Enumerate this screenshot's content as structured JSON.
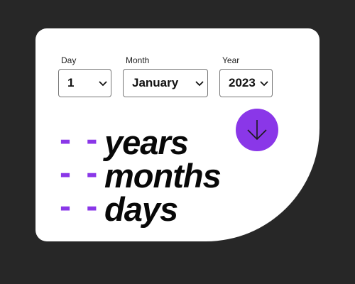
{
  "form": {
    "day": {
      "label": "Day",
      "value": "1"
    },
    "month": {
      "label": "Month",
      "value": "January"
    },
    "year": {
      "label": "Year",
      "value": "2023"
    }
  },
  "submit": {
    "icon": "arrow-down-icon",
    "color": "#8a37e8"
  },
  "results": [
    {
      "value": "- -",
      "unit": "years"
    },
    {
      "value": "- -",
      "unit": "months"
    },
    {
      "value": "- -",
      "unit": "days"
    }
  ],
  "colors": {
    "background": "#272727",
    "card": "#ffffff",
    "accent": "#8a37e8",
    "text": "#080808"
  }
}
